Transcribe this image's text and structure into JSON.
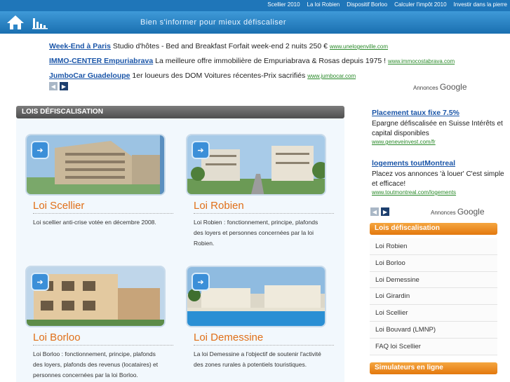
{
  "topnav": {
    "links": [
      "Scellier 2010",
      "La loi Robien",
      "Dispositif Borloo",
      "Calculer l'impôt 2010",
      "Investir dans la pierre"
    ]
  },
  "header": {
    "tagline": "Bien s'informer pour mieux défiscaliser",
    "icons": [
      "home-icon",
      "chart-icon"
    ]
  },
  "ads": {
    "items": [
      {
        "title": "Week-End à Paris",
        "text": " Studio d'hôtes - Bed and Breakfast Forfait week-end 2 nuits 250 € ",
        "url": "www.unelogenville.com"
      },
      {
        "title": "IMMO-CENTER Empuriabrava",
        "text": " La meilleure offre immobilière de Empuriabrava & Rosas depuis 1975 ! ",
        "url": "www.immocostabrava.com"
      },
      {
        "title": "JumboCar Guadeloupe",
        "text": " 1er loueurs des DOM Voitures récentes-Prix sacrifiés ",
        "url": "www.jumbocar.com"
      }
    ],
    "prev": "◀",
    "next": "▶",
    "annonces_label": "Annonces",
    "google_label": "Google"
  },
  "main": {
    "section_title": "LOIS DÉFISCALISATION",
    "cards": [
      {
        "title": "Loi Scellier",
        "text": "Loi scellier anti-crise votée en décembre 2008."
      },
      {
        "title": "Loi Robien",
        "text": "Loi Robien : fonctionnement, principe, plafonds des loyers et personnes concernées par la loi Robien."
      },
      {
        "title": "Loi Borloo",
        "text": "Loi Borloo : fonctionnement, principe, plafonds des loyers, plafonds des revenus (locataires) et personnes concernées par la loi Borloo."
      },
      {
        "title": "Loi Demessine",
        "text": "La loi Demessine a l'objectif de soutenir l'activité des zones rurales à potentiels touristiques."
      }
    ],
    "play_glyph": "➔"
  },
  "sidebar": {
    "ads": [
      {
        "title": "Placement taux fixe 7.5%",
        "text": "Epargne défiscalisée en Suisse Intérêts et capital disponibles",
        "url": "www.geneveinvest.com/fr"
      },
      {
        "title": "logements toutMontreal",
        "text": "Placez vos annonces 'à louer' C'est simple et efficace!",
        "url": "www.toutmontreal.com/logements"
      }
    ],
    "prev": "◀",
    "next": "▶",
    "annonces_label": "Annonces",
    "google_label": "Google",
    "lois_title": "Lois défiscalisation",
    "lois_items": [
      "Loi Robien",
      "Loi Borloo",
      "Loi Demessine",
      "Loi Girardin",
      "Loi Scellier",
      "Loi Bouvard (LMNP)",
      "FAQ loi Scellier"
    ],
    "simulateurs_title": "Simulateurs en ligne"
  },
  "colors": {
    "brand_blue": "#1f76b9",
    "accent_orange": "#e3780d",
    "link_blue": "#1a55a8",
    "url_green": "#2a8a2a"
  }
}
